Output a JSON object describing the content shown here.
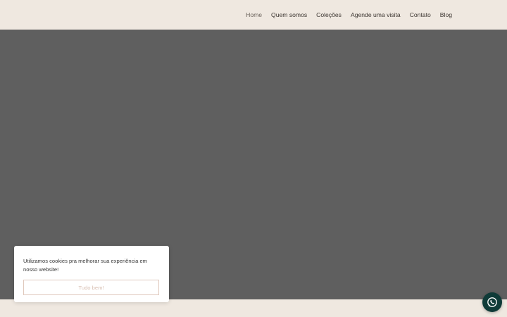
{
  "nav": {
    "items": [
      {
        "label": "Home"
      },
      {
        "label": "Quem somos"
      },
      {
        "label": "Coleções"
      },
      {
        "label": "Agende uma visita"
      },
      {
        "label": "Contato"
      },
      {
        "label": "Blog"
      }
    ]
  },
  "cookie_banner": {
    "message": "Utilizamos cookies pra melhorar sua experiência em nosso website!",
    "accept_label": "Tudo bem!"
  },
  "whatsapp": {
    "icon": "whatsapp-icon"
  },
  "colors": {
    "header_bg": "#efe8e0",
    "hero_bg": "#5f5f5f",
    "nav_text": "#3b3530",
    "accent_border": "#e0c9bd",
    "whatsapp_bg": "#0f3b38"
  }
}
